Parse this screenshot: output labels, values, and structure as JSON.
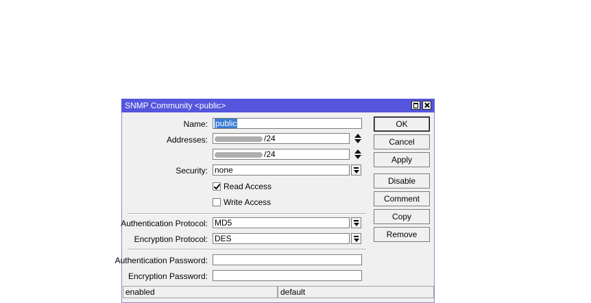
{
  "window": {
    "title": "SNMP Community <public>"
  },
  "form": {
    "name_label": "Name:",
    "name_value": "public",
    "addresses_label": "Addresses:",
    "address_1_suffix": "/24",
    "address_2_suffix": "/24",
    "security_label": "Security:",
    "security_value": "none",
    "read_access_label": "Read Access",
    "read_access_checked": true,
    "write_access_label": "Write Access",
    "write_access_checked": false,
    "auth_protocol_label": "Authentication Protocol:",
    "auth_protocol_value": "MD5",
    "enc_protocol_label": "Encryption Protocol:",
    "enc_protocol_value": "DES",
    "auth_password_label": "Authentication Password:",
    "auth_password_value": "",
    "enc_password_label": "Encryption Password:",
    "enc_password_value": ""
  },
  "buttons": {
    "ok": "OK",
    "cancel": "Cancel",
    "apply": "Apply",
    "disable": "Disable",
    "comment": "Comment",
    "copy": "Copy",
    "remove": "Remove"
  },
  "status": {
    "left": "enabled",
    "right": "default"
  },
  "colors": {
    "titlebar": "#5555dd",
    "selection": "#3a7bd5"
  }
}
